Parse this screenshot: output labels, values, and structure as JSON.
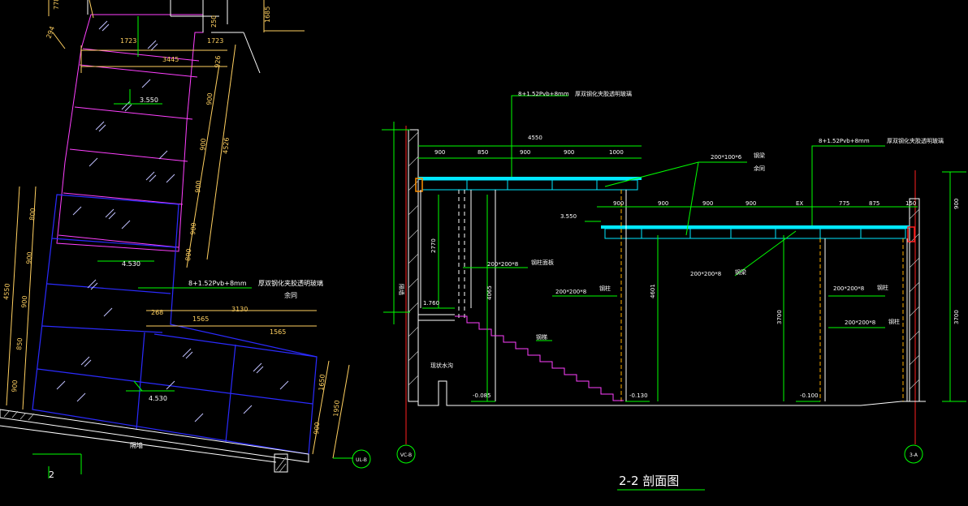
{
  "plan": {
    "dims_top": [
      "1723",
      "1723",
      "3445",
      "294",
      "778",
      "1685",
      "250"
    ],
    "dims_right": [
      "926",
      "900",
      "4526",
      "900",
      "900",
      "900",
      "800"
    ],
    "dims_left": [
      "800",
      "900",
      "4550",
      "900",
      "850",
      "900"
    ],
    "dims_bottom_group": [
      "268",
      "3130",
      "1565",
      "1565"
    ],
    "dims_far_right": [
      "1650",
      "1950",
      "900"
    ],
    "levels": [
      "3.550",
      "4.530",
      "4.530"
    ],
    "glass_note": "8+1.52Pvb+8mm",
    "glass_desc": "厚双钢化夹胶透明玻璃",
    "glass_desc2": "余同",
    "wall_label": "隔墙",
    "axis_label": "UL-B",
    "section_marker": "2"
  },
  "section": {
    "title": "2-2  剖面图",
    "top_glass_note": "8+1.52Pvb+8mm",
    "top_glass_desc": "厚双钢化夹胶透明玻璃",
    "right_glass_note": "8+1.52Pvb+8mm",
    "right_glass_desc": "厚双钢化夹胶透明玻璃",
    "beam_note": "200*100*6",
    "beam_label": "钢梁",
    "beam_label2": "余同",
    "overall_width": "4550",
    "upper_dims": [
      "900",
      "850",
      "900",
      "900",
      "1000"
    ],
    "lower_dims": [
      "900",
      "900",
      "900",
      "900",
      "EX",
      "775",
      "875",
      "150"
    ],
    "level_355": "3.550",
    "level_176": "1.760",
    "level_m085": "-0.085",
    "level_m130": "-0.130",
    "level_m100": "-0.100",
    "col_note1": "200*200*8",
    "col_label1": "钢柱面板",
    "col_note2": "200*200*8",
    "col_label2": "钢柱",
    "col_note3": "200*200*8",
    "col_label3": "钢梁",
    "col_note4": "200*200*8",
    "col_label4": "钢柱",
    "col_note5": "200*200*8",
    "col_label5": "钢柱",
    "stair_label": "钢梯",
    "pit_label": "现状水沟",
    "wall_label": "隔墙",
    "vert_dims": [
      "2770",
      "4065",
      "4601",
      "3700",
      "900",
      "3700"
    ],
    "axis_left": "VC-B",
    "axis_right": "3-A"
  },
  "colors": {
    "background": "#000000",
    "glass_outline": "#ff40ff",
    "blue_frame": "#2b2bff",
    "dim": "#ffd060",
    "annot": "#ffffff",
    "leader": "#00ff00",
    "cyan": "#00e8ff",
    "axis": "#ff2020",
    "column": "#ffb000"
  }
}
